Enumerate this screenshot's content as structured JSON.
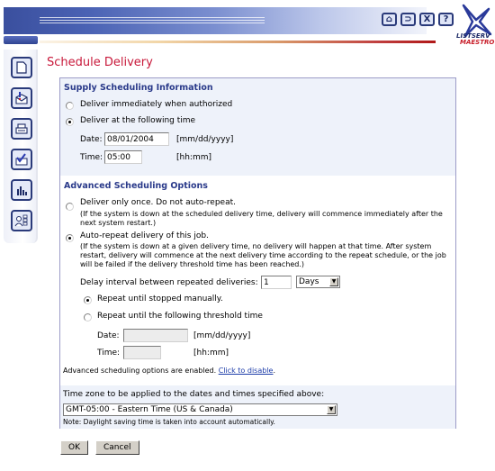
{
  "header": {
    "tool_icons": [
      {
        "name": "home-icon",
        "glyph": "⌂"
      },
      {
        "name": "back-icon",
        "glyph": "⊃"
      },
      {
        "name": "close-icon",
        "glyph": "X"
      },
      {
        "name": "help-icon",
        "glyph": "?"
      }
    ],
    "logo_line1": "LISTSERV",
    "logo_line2": "MAESTRO"
  },
  "sidebar": {
    "items": [
      {
        "name": "new-document"
      },
      {
        "name": "message"
      },
      {
        "name": "print-drafts"
      },
      {
        "name": "approve"
      },
      {
        "name": "reports"
      },
      {
        "name": "users"
      }
    ]
  },
  "page": {
    "title": "Schedule Delivery"
  },
  "supply": {
    "heading": "Supply Scheduling Information",
    "option_immediate": "Deliver immediately when authorized",
    "option_at_time": "Deliver at the following time",
    "selected": "at_time",
    "date_label": "Date:",
    "date_value": "08/01/2004",
    "date_format": "[mm/dd/yyyy]",
    "time_label": "Time:",
    "time_value": "05:00",
    "time_format": "[hh:mm]"
  },
  "advanced": {
    "heading": "Advanced Scheduling Options",
    "option_once": "Deliver only once. Do not auto-repeat.",
    "option_once_note": "(If the system is down at the scheduled delivery time, delivery will commence immediately after the next system restart.)",
    "option_repeat": "Auto-repeat delivery of this job.",
    "option_repeat_note": "(If the system is down at a given delivery time, no delivery will happen at that time. After system restart, delivery will commence at the next delivery time according to the repeat schedule, or the job will be failed if the delivery threshold time has been reached.)",
    "selected": "repeat",
    "delay_label": "Delay interval between repeated deliveries:",
    "delay_value": "1",
    "delay_unit": "Days",
    "repeat_manual": "Repeat until stopped manually.",
    "repeat_threshold": "Repeat until the following threshold time",
    "repeat_selected": "manual",
    "threshold_date_label": "Date:",
    "threshold_date_value": "",
    "threshold_date_format": "[mm/dd/yyyy]",
    "threshold_time_label": "Time:",
    "threshold_time_value": "",
    "threshold_time_format": "[hh:mm]",
    "status_text": "Advanced scheduling options are enabled.",
    "disable_link": "Click to disable",
    "status_suffix": "."
  },
  "timezone": {
    "label": "Time zone to be applied to the dates and times specified above:",
    "value": "GMT-05:00 - Eastern Time (US & Canada)",
    "note": "Note: Daylight saving time is taken into account automatically."
  },
  "actions": {
    "ok_label": "OK",
    "cancel_label": "Cancel"
  },
  "colors": {
    "title": "#c8183a",
    "heading": "#2a3a8a",
    "panel_border": "#9c9cc8",
    "section_bg": "#eef2fa",
    "link": "#1a3aa8"
  }
}
